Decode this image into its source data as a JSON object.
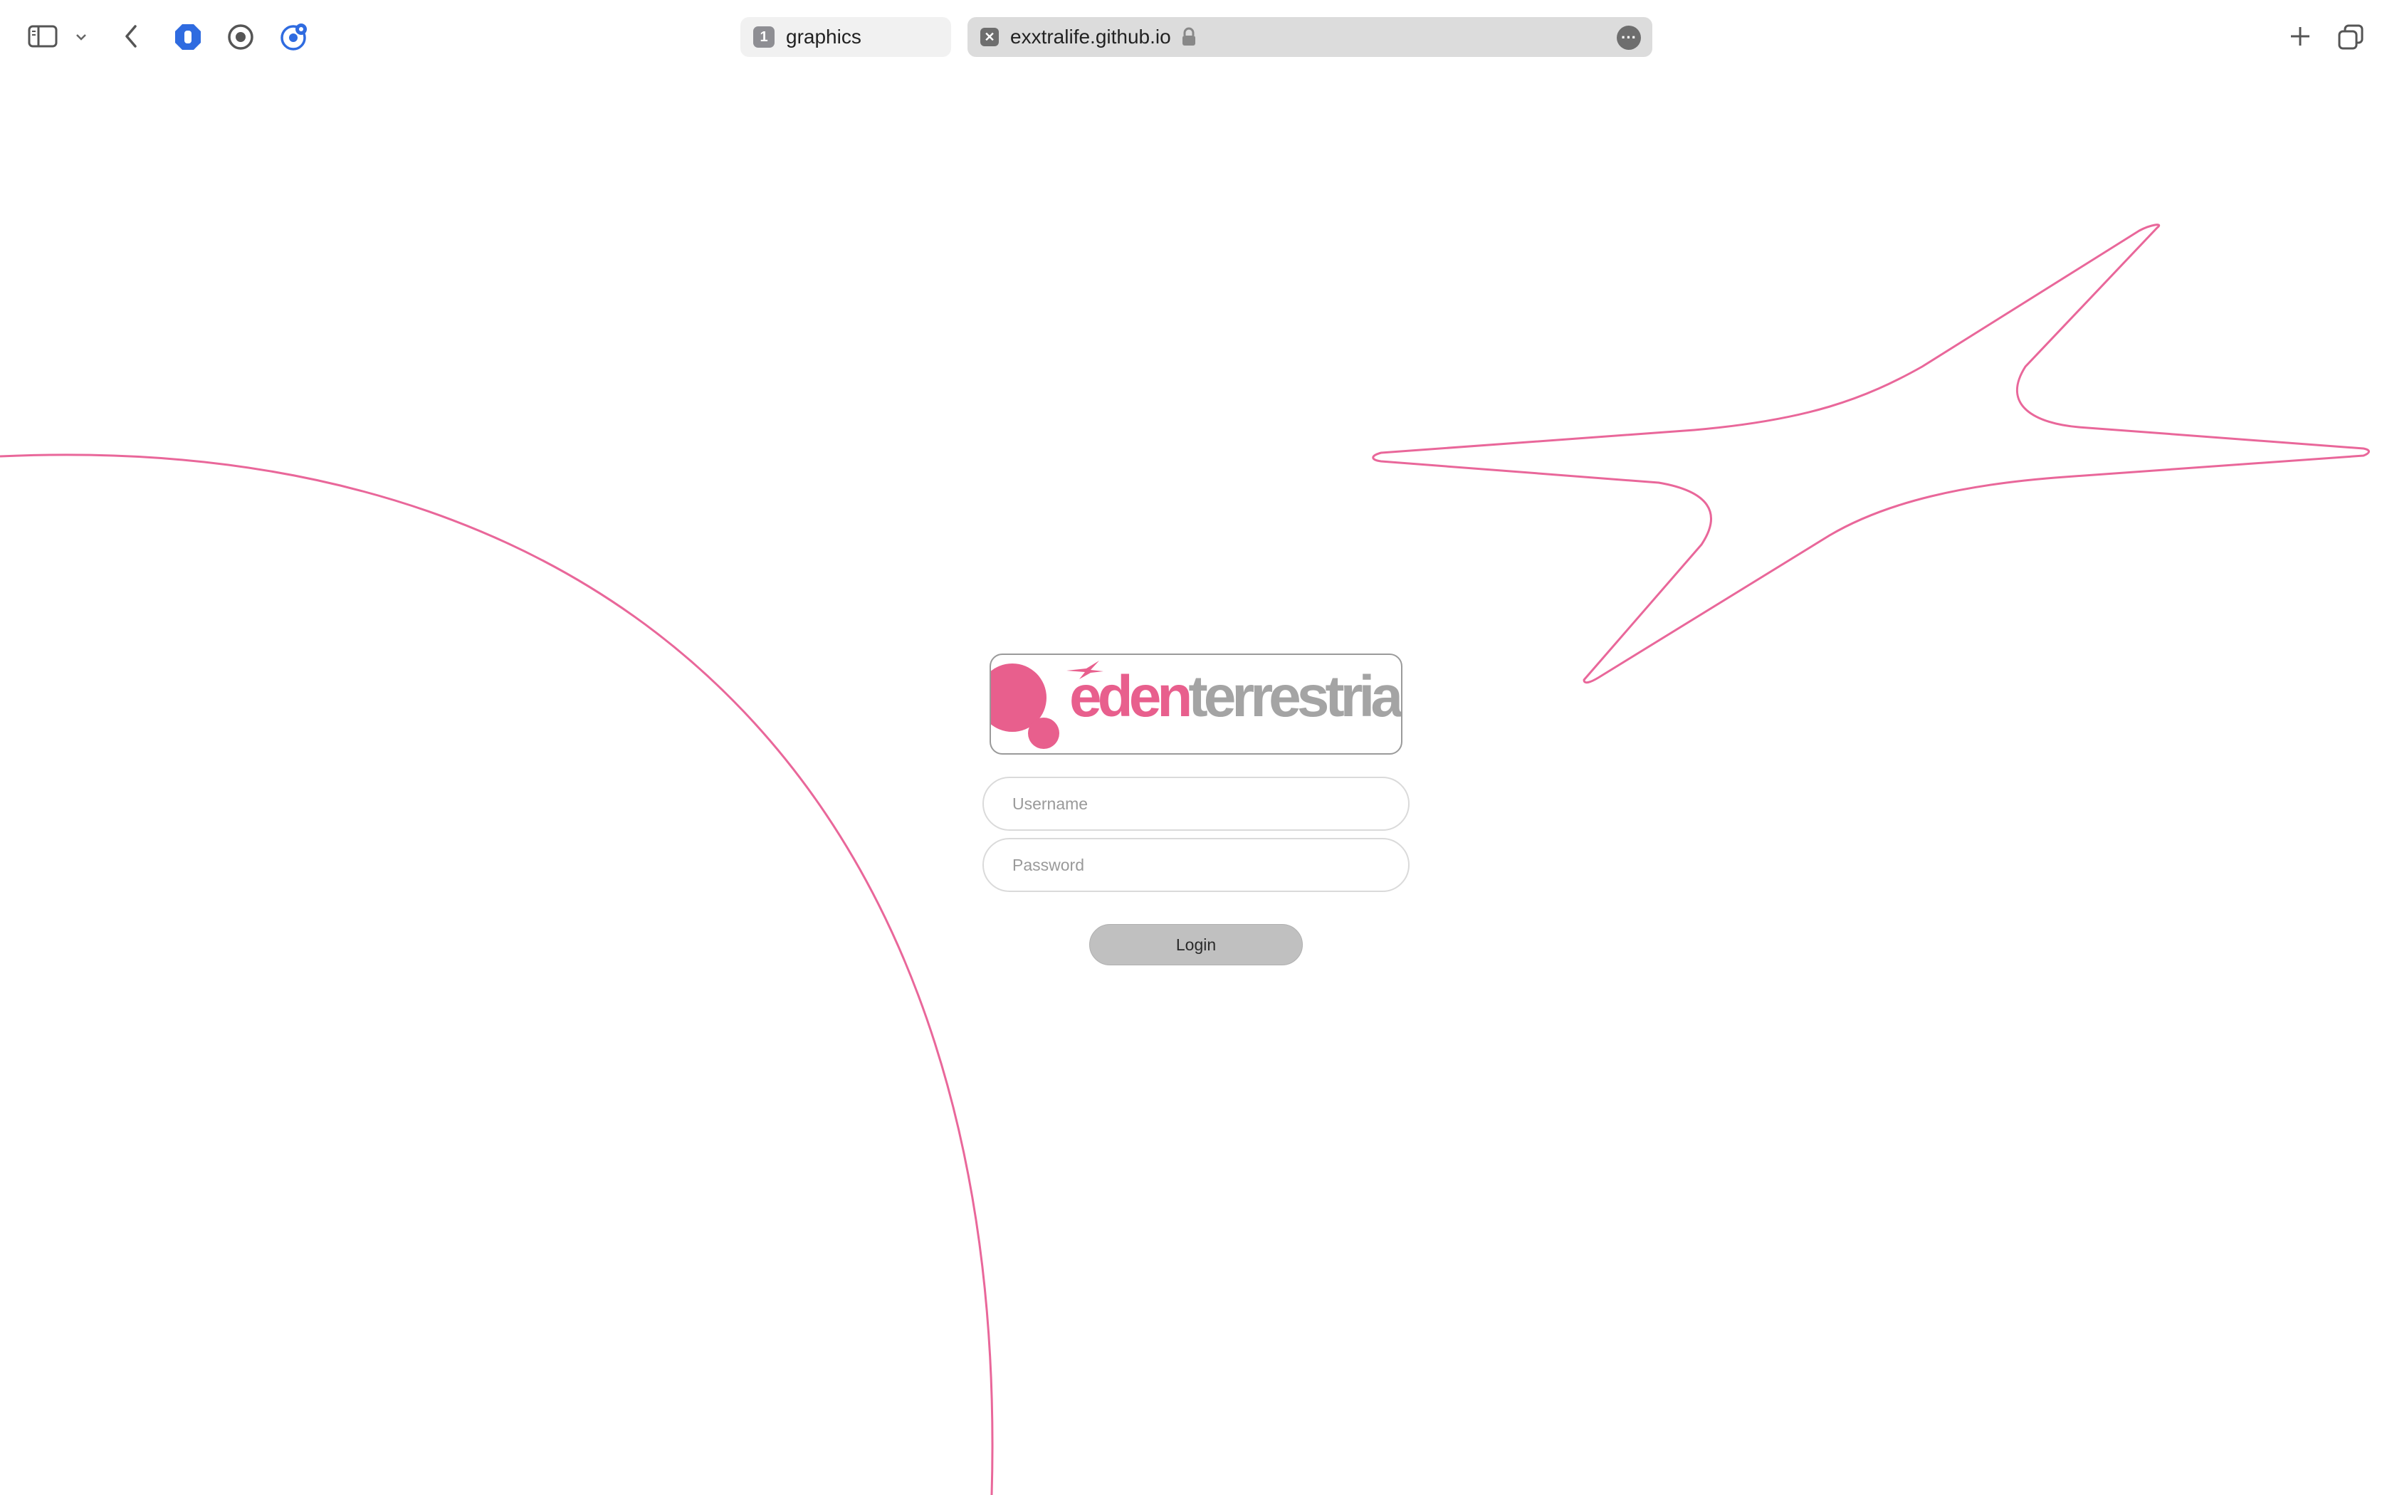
{
  "browser": {
    "tabs": [
      {
        "number": "1",
        "label": "graphics",
        "active": false
      },
      {
        "label": "exxtralife.github.io",
        "active": true
      }
    ],
    "icons": {
      "sidebar": "sidebar-icon",
      "chevron": "chevron-down-icon",
      "back": "back-arrow-icon",
      "extension_1": "blocker-shield-icon",
      "extension_2": "record-icon",
      "extension_3": "profile-badge-icon",
      "lock": "lock-icon",
      "more": "more-icon",
      "new_tab": "plus-icon",
      "tab_overview": "tab-overview-icon"
    }
  },
  "login": {
    "logo": {
      "part1": "eden",
      "part2": "terrestrial"
    },
    "username": {
      "placeholder": "Username",
      "value": ""
    },
    "password": {
      "placeholder": "Password",
      "value": ""
    },
    "button_label": "Login"
  },
  "colors": {
    "brand_pink": "#e85f8d",
    "brand_gray": "#a4a4a4",
    "accent_blue": "#2f6be0",
    "button_gray": "#c0c0c0"
  }
}
